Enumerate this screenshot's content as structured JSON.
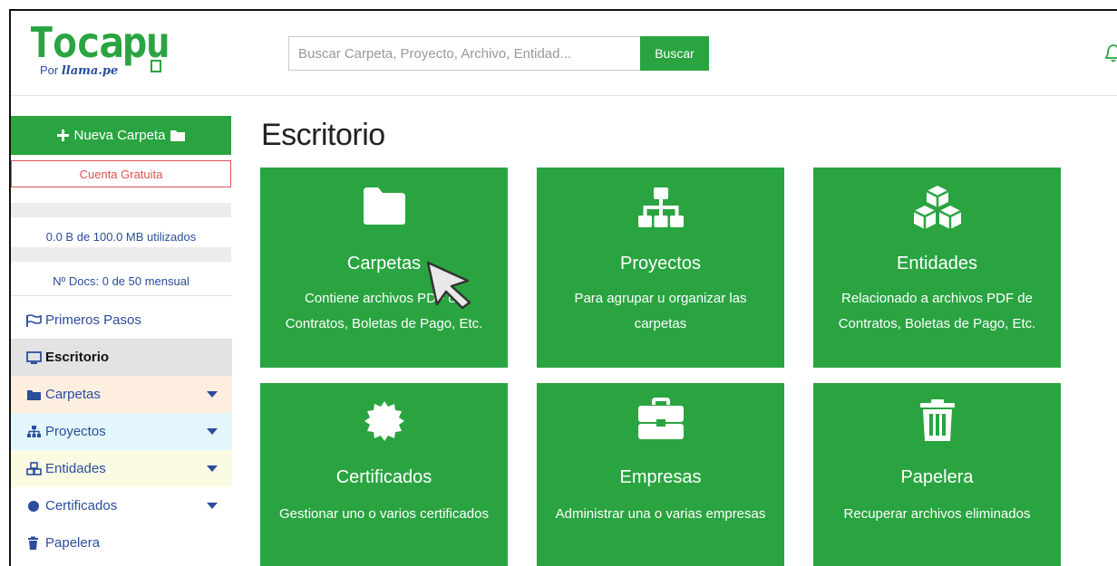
{
  "header": {
    "logo_name": "Tocapu",
    "logo_by": "Por",
    "logo_brand": "llama.pe",
    "search_placeholder": "Buscar Carpeta, Proyecto, Archivo, Entidad...",
    "search_button": "Buscar"
  },
  "sidebar": {
    "new_folder": "Nueva Carpeta",
    "account": "Cuenta Gratuita",
    "storage_used": "0.0 B de 100.0 MB utilizados",
    "docs_used": "Nº Docs: 0 de 50 mensual",
    "storage_fraction": 0,
    "docs_fraction": 0,
    "items": [
      {
        "label": "Primeros Pasos",
        "icon": "flag-icon",
        "color": "#ffffff",
        "caret": false
      },
      {
        "label": "Escritorio",
        "icon": "desktop-icon",
        "color": "#e3e3e3",
        "caret": false,
        "active": true
      },
      {
        "label": "Carpetas",
        "icon": "folder-icon",
        "color": "#fdeee0",
        "caret": true
      },
      {
        "label": "Proyectos",
        "icon": "sitemap-icon",
        "color": "#e2f6fb",
        "caret": true
      },
      {
        "label": "Entidades",
        "icon": "cubes-icon",
        "color": "#fbfbe3",
        "caret": true
      },
      {
        "label": "Certificados",
        "icon": "certificate-icon",
        "color": "#ffffff",
        "caret": true
      },
      {
        "label": "Papelera",
        "icon": "trash-icon",
        "color": "#ffffff",
        "caret": false
      }
    ]
  },
  "main": {
    "title": "Escritorio",
    "tiles": [
      {
        "title": "Carpetas",
        "desc": "Contiene archivos PDF de Contratos, Boletas de Pago, Etc.",
        "icon": "folder-icon"
      },
      {
        "title": "Proyectos",
        "desc": "Para agrupar u organizar las carpetas",
        "icon": "sitemap-icon"
      },
      {
        "title": "Entidades",
        "desc": "Relacionado a archivos PDF de Contratos, Boletas de Pago, Etc.",
        "icon": "cubes-icon"
      },
      {
        "title": "Certificados",
        "desc": "Gestionar uno o varios certificados",
        "icon": "certificate-icon"
      },
      {
        "title": "Empresas",
        "desc": "Administrar una o varias empresas",
        "icon": "briefcase-icon"
      },
      {
        "title": "Papelera",
        "desc": "Recuperar archivos eliminados",
        "icon": "trash-icon"
      }
    ]
  },
  "colors": {
    "accent": "#2aa441",
    "link": "#2a4d9c",
    "danger": "#d9534f"
  }
}
